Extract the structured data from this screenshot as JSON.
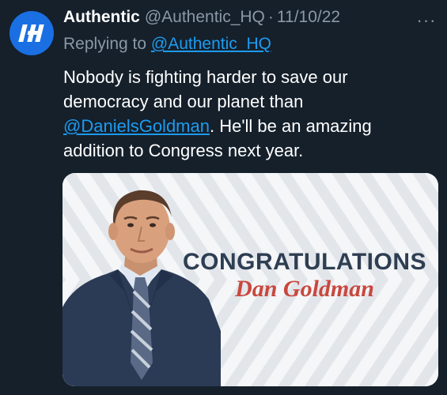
{
  "tweet": {
    "display_name": "Authentic",
    "handle": "@Authentic_HQ",
    "separator": "·",
    "date": "11/10/22",
    "more_icon": "more-horizontal-icon",
    "more_label": "···",
    "replying_prefix": "Replying to",
    "replying_to": "@Authentic_HQ",
    "body": {
      "line1": "Nobody is fighting harder to save our democracy and our planet than ",
      "mention": "@DanielsGoldman",
      "line2": ". He'll be an amazing addition to Congress next year."
    },
    "avatar_icon": "authentic-logo-icon"
  },
  "media": {
    "headline": "CONGRATULATIONS",
    "name": "Dan Goldman",
    "headline_color": "#2e3e52",
    "name_color": "#c8483e",
    "pattern_color": "#e2e6ea"
  },
  "colors": {
    "background": "#15202b",
    "text": "#ffffff",
    "secondary": "#8b98a5",
    "link": "#1d9bf0",
    "avatar": "#1a6fe3"
  }
}
